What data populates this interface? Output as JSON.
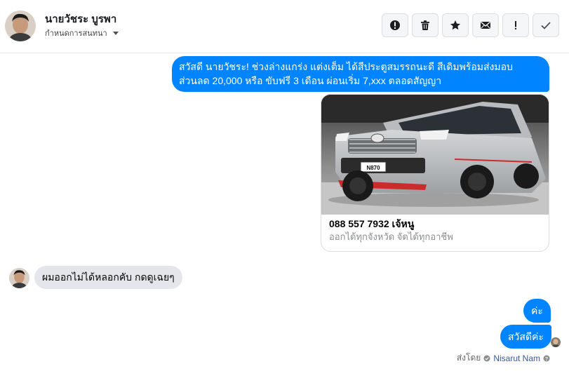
{
  "header": {
    "contact_name": "นายวัชระ บูรพา",
    "subtitle": "กำหนดการสนทนา"
  },
  "toolbar": {
    "buttons": [
      {
        "name": "alert-circle-icon"
      },
      {
        "name": "trash-icon"
      },
      {
        "name": "star-icon"
      },
      {
        "name": "envelope-icon"
      },
      {
        "name": "exclamation-icon"
      },
      {
        "name": "checkmark-icon"
      }
    ]
  },
  "messages": {
    "outgoing_1": "สวัสดี นายวัชระ! ช่วงล่างแกร่ง แต่งเต็ม ได้สีประตูสมรรถนะดี สีเดิมพร้อมส่งมอบ ส่วนลด 20,000 หรือ ขับฟรี 3 เดือน ผ่อนเริ่ม 7,xxx ตลอดสัญญา",
    "card": {
      "image_plate": "N870",
      "title": "088 557 7932 เจ้หนู",
      "description": "ออกได้ทุกจังหวัด จัดได้ทุกอาชีพ"
    },
    "incoming_1": "ผมออกไม่ได้หลอกคับ กดดูเฉยๆ",
    "outgoing_2": "ค่ะ",
    "outgoing_3": "สวัสดีค่ะ"
  },
  "footer": {
    "sent_by_label": "ส่งโดย",
    "sender_name": "Nisarut Nam"
  },
  "colors": {
    "outgoing_bubble": "#0084ff",
    "incoming_bubble": "#e4e6eb",
    "muted_text": "#8a8d91"
  }
}
